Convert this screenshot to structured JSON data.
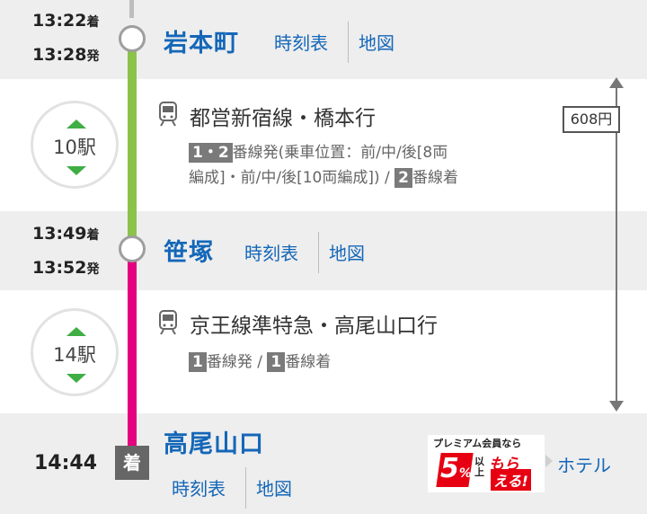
{
  "colors": {
    "link": "#1467b8",
    "green_line": "#8bc34a",
    "pink_line": "#e4007f",
    "band": "#eeeeee"
  },
  "stations": [
    {
      "arrive_time": "13:22",
      "arrive_suffix": "着",
      "depart_time": "13:28",
      "depart_suffix": "発",
      "name": "岩本町",
      "timetable": "時刻表",
      "map": "地図"
    },
    {
      "arrive_time": "13:49",
      "arrive_suffix": "着",
      "depart_time": "13:52",
      "depart_suffix": "発",
      "name": "笹塚",
      "timetable": "時刻表",
      "map": "地図"
    },
    {
      "arrive_time": "14:44",
      "name": "高尾山口",
      "timetable": "時刻表",
      "map": "地図",
      "arrive_badge": "着",
      "hotel": "ホテル"
    }
  ],
  "segments": [
    {
      "stops": "10駅",
      "line": "都営新宿線・橋本行",
      "depart_badge": "1・2",
      "depart_text": "番線発(乗車位置：前/中/後[8両",
      "depart_text2": "編成]・前/中/後[10両編成]) / ",
      "arrive_badge": "2",
      "arrive_text": "番線着"
    },
    {
      "stops": "14駅",
      "line": "京王線準特急・高尾山口行",
      "depart_badge": "1",
      "depart_text": "番線発 / ",
      "arrive_badge": "1",
      "arrive_text": "番線着"
    }
  ],
  "fare": "608円",
  "ad": {
    "top": "プレミアム会員なら",
    "percent": "5",
    "unit": "%",
    "small": "以上",
    "word1": "もら",
    "word2": "える!"
  }
}
